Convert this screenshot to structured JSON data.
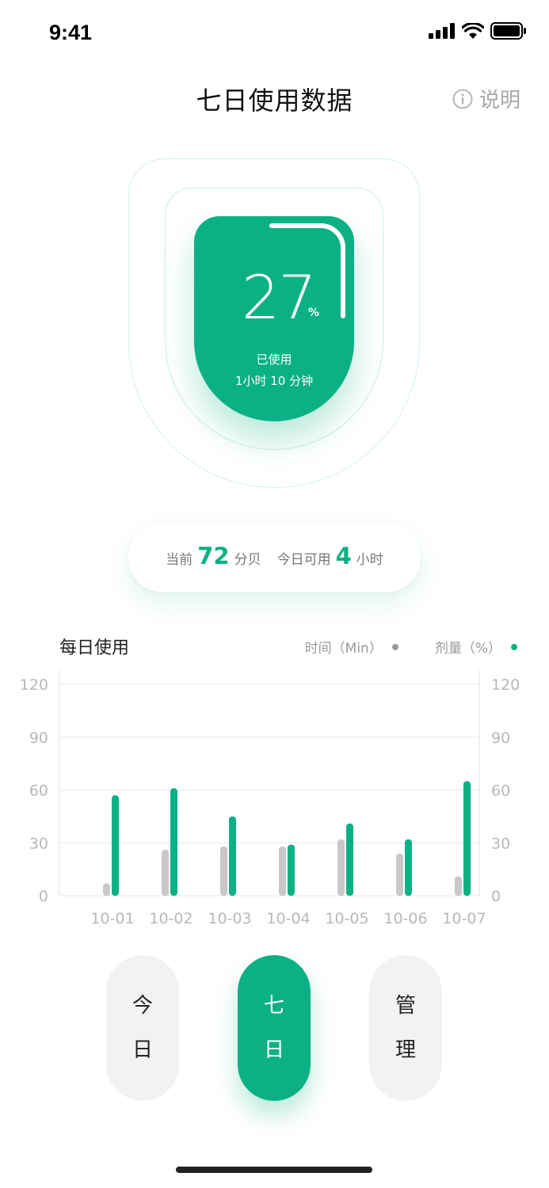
{
  "status_bar": {
    "time": "9:41",
    "icons": [
      "cellular-signal-icon",
      "wifi-icon",
      "battery-icon"
    ]
  },
  "header": {
    "title": "七日使用数据",
    "help_label": "说明",
    "help_icon": "info-icon"
  },
  "gauge": {
    "value": "27",
    "unit": "%",
    "progress_fraction": 0.27,
    "label": "已使用",
    "duration": "1小时 10 分钟"
  },
  "info": {
    "prefix": "当前",
    "decibel_value": "72",
    "decibel_unit": "分贝",
    "available_prefix": "今日可用",
    "available_value": "4",
    "available_unit": "小时"
  },
  "chart_section": {
    "title": "每日使用",
    "legend_time": "时间（Min）",
    "legend_dose": "剂量（%）"
  },
  "colors": {
    "accent": "#0bb184",
    "time_bar": "#c8c8c8",
    "text_muted": "#9a9a9a"
  },
  "chart_data": {
    "type": "bar",
    "title": "每日使用",
    "categories": [
      "10-01",
      "10-02",
      "10-03",
      "10-04",
      "10-05",
      "10-06",
      "10-07"
    ],
    "series": [
      {
        "name": "时间（Min）",
        "color": "#c8c8c8",
        "values": [
          7,
          26,
          28,
          28,
          32,
          24,
          11
        ]
      },
      {
        "name": "剂量（%）",
        "color": "#0bb184",
        "values": [
          57,
          61,
          45,
          29,
          41,
          32,
          65
        ]
      }
    ],
    "y_ticks": [
      "0",
      "30",
      "60",
      "90",
      "120"
    ],
    "ylim": [
      0,
      120
    ],
    "grid": true,
    "legend": "top-right"
  },
  "nav": {
    "tabs": [
      {
        "chars": [
          "今",
          "日"
        ],
        "active": false
      },
      {
        "chars": [
          "七",
          "日"
        ],
        "active": true
      },
      {
        "chars": [
          "管",
          "理"
        ],
        "active": false
      }
    ]
  }
}
